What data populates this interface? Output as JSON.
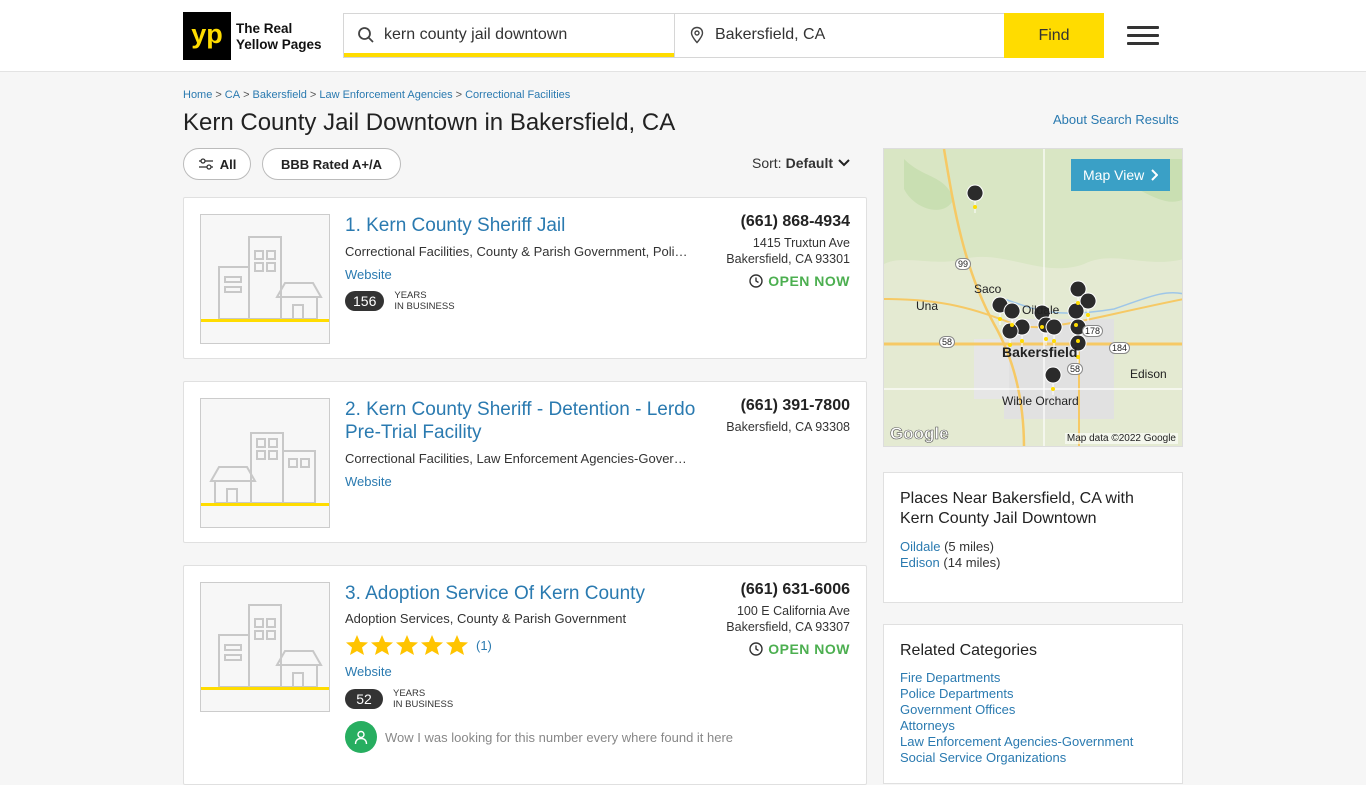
{
  "header": {
    "logo": "yp",
    "logo_line1": "The Real",
    "logo_line2": "Yellow Pages",
    "search_value": "kern county jail downtown",
    "location_value": "Bakersfield, CA",
    "find_label": "Find"
  },
  "breadcrumb": [
    "Home",
    "CA",
    "Bakersfield",
    "Law Enforcement Agencies",
    "Correctional Facilities"
  ],
  "page_title": "Kern County Jail Downtown in Bakersfield, CA",
  "about_link": "About Search Results",
  "filters": {
    "all_label": "All",
    "bbb_label": "BBB Rated A+/A",
    "sort_prefix": "Sort:",
    "sort_value": "Default"
  },
  "results": [
    {
      "name": "1. Kern County Sheriff Jail",
      "cats": [
        {
          "t": "Correctional Facilities",
          "s": ", "
        },
        {
          "t": "County & Parish Government",
          "s": ", "
        },
        {
          "t": "Police Departments",
          "s": ""
        }
      ],
      "website": "Website",
      "phone": "(661) 868-4934",
      "street": "1415 Truxtun Ave",
      "city": "Bakersfield, CA 93301",
      "open": "OPEN NOW",
      "years": "156",
      "years_l1": "YEARS",
      "years_l2": "IN BUSINESS"
    },
    {
      "name": "2. Kern County Sheriff - Detention - Lerdo Pre-Trial Facility",
      "cats": [
        {
          "t": "Correctional Facilities",
          "s": ", "
        },
        {
          "t": "Law Enforcement Agencies-Government",
          "s": ""
        }
      ],
      "website": "Website",
      "phone": "(661) 391-7800",
      "city": "Bakersfield, CA 93308"
    },
    {
      "name": "3. Adoption Service Of Kern County",
      "cats": [
        {
          "t": "Adoption Services",
          "s": ", "
        },
        {
          "t": "County & Parish Government",
          "s": ""
        }
      ],
      "rating": 5,
      "rating_count": "(1)",
      "website": "Website",
      "phone": "(661) 631-6006",
      "street": "100 E California Ave",
      "city": "Bakersfield, CA 93307",
      "open": "OPEN NOW",
      "years": "52",
      "years_l1": "YEARS",
      "years_l2": "IN BUSINESS",
      "snippet": "Wow I was looking for this number every where found it here"
    }
  ],
  "map": {
    "button": "Map View",
    "labels": [
      "Saco",
      "Una",
      "Oildale",
      "Bakersfield",
      "Edison",
      "Wible Orchard"
    ],
    "shields": [
      "99",
      "58",
      "178",
      "184",
      "58"
    ],
    "google": "Google",
    "credit": "Map data ©2022 Google"
  },
  "places": {
    "title": "Places Near Bakersfield, CA with Kern County Jail Downtown",
    "items": [
      {
        "name": "Oildale",
        "dist": "(5 miles)"
      },
      {
        "name": "Edison",
        "dist": "(14 miles)"
      }
    ]
  },
  "related": {
    "title": "Related Categories",
    "items": [
      "Fire Departments",
      "Police Departments",
      "Government Offices",
      "Attorneys",
      "Law Enforcement Agencies-Government",
      "Social Service Organizations"
    ]
  },
  "colors": {
    "brand_yellow": "#ffdc00",
    "link_blue": "#2a7ab0",
    "open_green": "#4caf50",
    "map_button": "#3aa0c6"
  }
}
